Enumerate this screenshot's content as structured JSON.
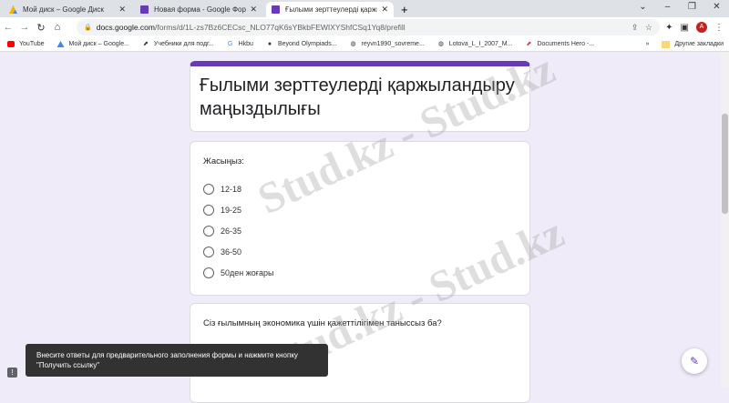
{
  "browser": {
    "tabs": [
      {
        "label": "Мой диск – Google Диск"
      },
      {
        "label": "Новая форма - Google Формы"
      },
      {
        "label": "Ғылыми зерттеулерді қаржыландыру"
      }
    ],
    "url_domain": "docs.google.com",
    "url_path": "/forms/d/1L-zs7Bz6CECsc_NLO77qK6sYBkbFEWIXYShfCSq1Yq8/prefill",
    "avatar": "A",
    "bookmarks": [
      "YouTube",
      "Мой диск – Google...",
      "Учебники для подг...",
      "Hkbu",
      "Beyond Olympiads...",
      "reyvn1990_sovreme...",
      "Lotova_L_I_2007_M...",
      "Documents Hero -..."
    ],
    "other_bookmarks": "Другие закладки"
  },
  "form": {
    "title": "Ғылыми зерттеулерді қаржыландыру маңыздылығы",
    "q1": {
      "text": "Жасыңыз:",
      "options": [
        "12-18",
        "19-25",
        "26-35",
        "36-50",
        "50ден жоғары"
      ]
    },
    "q2": {
      "text": "Сіз ғылымның экономика үшін қажеттілігімен таныссыз ба?"
    }
  },
  "snackbar": "Внесите ответы для предварительного заполнения формы и нажмите кнопку \"Получить ссылку\"",
  "watermark": "Stud.kz - Stud.kz"
}
